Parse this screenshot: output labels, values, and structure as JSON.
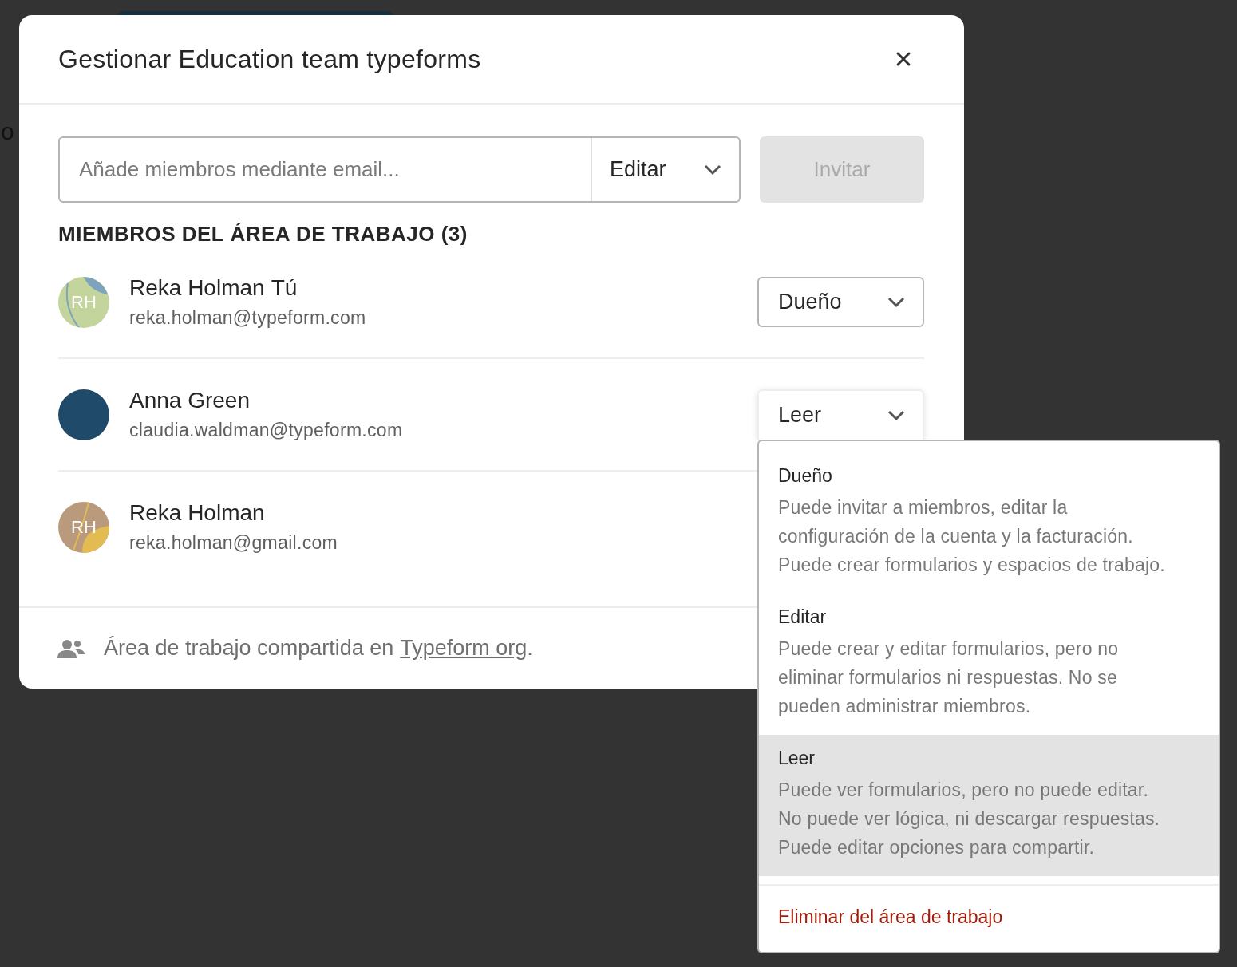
{
  "background": {
    "text_fragment": "o"
  },
  "dialog": {
    "title": "Gestionar Education team typeforms"
  },
  "invite": {
    "placeholder": "Añade miembros mediante email...",
    "role": "Editar",
    "button": "Invitar",
    "button_disabled": true
  },
  "members_heading": "MIEMBROS DEL ÁREA DE TRABAJO (3)",
  "members": [
    {
      "name": "Reka Holman",
      "tag": "Tú",
      "email": "reka.holman@typeform.com",
      "initials": "RH",
      "kind": "leaf",
      "role": "Dueño",
      "expanded": false
    },
    {
      "name": "Anna Green",
      "email": "claudia.waldman@typeform.com",
      "kind": "solid",
      "role": "Leer",
      "expanded": true
    },
    {
      "name": "Reka Holman",
      "email": "reka.holman@gmail.com",
      "initials": "RH",
      "kind": "sand"
    }
  ],
  "footer": {
    "text": "Área de trabajo compartida en",
    "link": "Typeform org",
    "after": "."
  },
  "role_menu": {
    "options": [
      {
        "title": "Dueño",
        "description_lines": [
          "Puede invitar a miembros, editar la",
          "configuración de la cuenta y la facturación.",
          "Puede crear formularios y espacios de trabajo."
        ],
        "selected": false
      },
      {
        "title": "Editar",
        "description_lines": [
          "Puede crear y editar formularios, pero no",
          "eliminar formularios ni respuestas. No se",
          "pueden administrar miembros."
        ],
        "selected": false
      },
      {
        "title": "Leer",
        "description_lines": [
          "Puede ver formularios, pero no puede editar.",
          "No puede ver lógica, ni descargar respuestas.",
          "Puede editar opciones para compartir."
        ],
        "selected": true
      }
    ],
    "remove": "Eliminar del área de trabajo"
  }
}
